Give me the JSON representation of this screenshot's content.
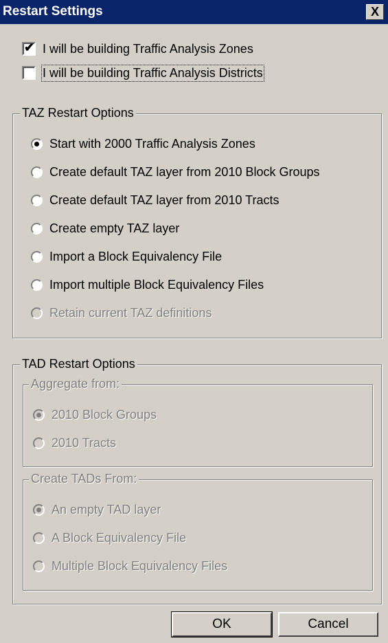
{
  "window": {
    "title": "Restart Settings",
    "close_label": "X"
  },
  "checkboxes": {
    "build_zones": {
      "label": "I will be building Traffic Analysis Zones",
      "checked": true
    },
    "build_districts": {
      "label": "I will be building Traffic Analysis Districts",
      "checked": false
    }
  },
  "taz_options": {
    "legend": "TAZ Restart Options",
    "items": [
      {
        "label": "Start with 2000 Traffic Analysis Zones",
        "selected": true,
        "enabled": true
      },
      {
        "label": "Create default TAZ layer from 2010 Block Groups",
        "selected": false,
        "enabled": true
      },
      {
        "label": "Create default TAZ layer from 2010 Tracts",
        "selected": false,
        "enabled": true
      },
      {
        "label": "Create empty TAZ layer",
        "selected": false,
        "enabled": true
      },
      {
        "label": "Import a Block Equivalency File",
        "selected": false,
        "enabled": true
      },
      {
        "label": "Import multiple Block Equivalency Files",
        "selected": false,
        "enabled": true
      },
      {
        "label": "Retain current TAZ definitions",
        "selected": false,
        "enabled": false
      }
    ]
  },
  "tad_options": {
    "legend": "TAD Restart Options",
    "aggregate": {
      "legend": "Aggregate from:",
      "items": [
        {
          "label": "2010 Block Groups",
          "selected": true
        },
        {
          "label": "2010 Tracts",
          "selected": false
        }
      ]
    },
    "create": {
      "legend": "Create TADs From:",
      "items": [
        {
          "label": "An empty TAD layer",
          "selected": true
        },
        {
          "label": "A Block Equivalency File",
          "selected": false
        },
        {
          "label": "Multiple Block Equivalency Files",
          "selected": false
        }
      ]
    }
  },
  "buttons": {
    "ok": "OK",
    "cancel": "Cancel"
  }
}
